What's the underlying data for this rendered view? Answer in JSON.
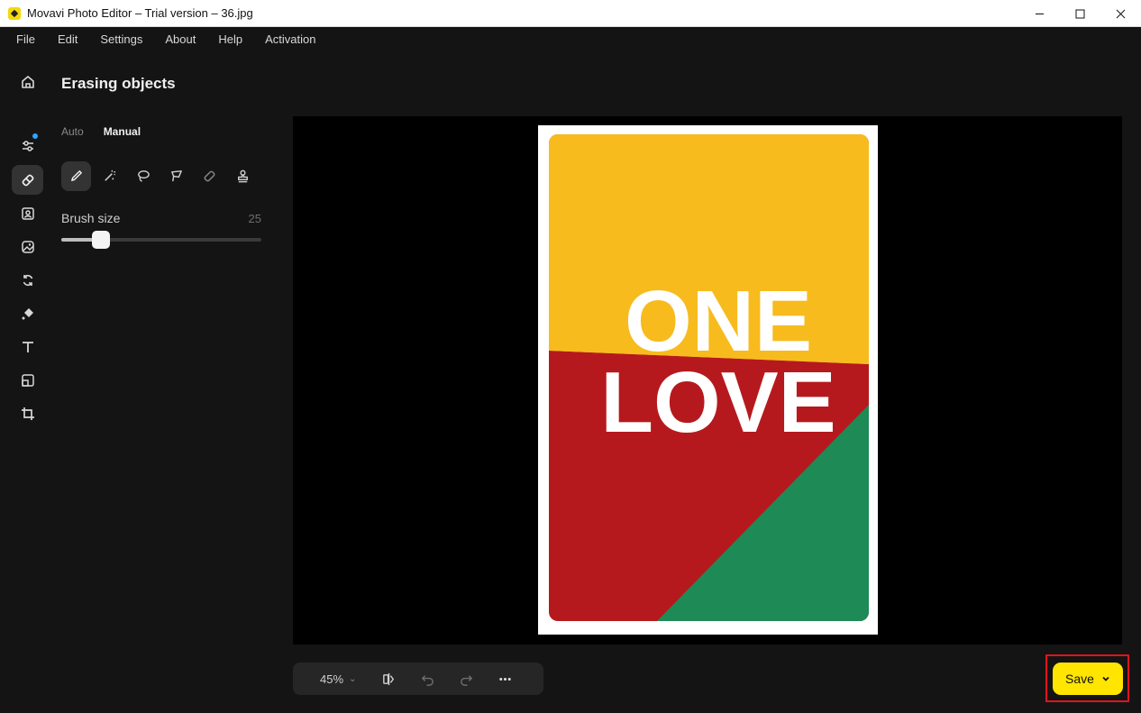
{
  "window": {
    "title": "Movavi Photo Editor – Trial version – 36.jpg",
    "controls": [
      "minimize",
      "maximize",
      "close"
    ]
  },
  "menu": [
    "File",
    "Edit",
    "Settings",
    "About",
    "Help",
    "Activation"
  ],
  "rail": {
    "items": [
      "home-icon",
      "adjust-icon",
      "eraser-icon",
      "portrait-icon",
      "replace-background-icon",
      "transform-icon",
      "effects-icon",
      "text-icon",
      "frame-icon",
      "crop-icon"
    ],
    "active": "eraser-icon"
  },
  "panel": {
    "title": "Erasing objects",
    "modes": [
      "Auto",
      "Manual"
    ],
    "active_mode": "Manual",
    "tools": [
      "brush-icon",
      "magic-wand-icon",
      "lasso-icon",
      "polygon-lasso-icon",
      "eraser-tool-icon",
      "stamp-icon"
    ],
    "brush_size_label": "Brush size",
    "brush_size_value": "25",
    "brush_size_fraction": 0.2
  },
  "image": {
    "line1": "ONE",
    "line2": "LOVE",
    "colors": {
      "yellow": "#f7bb1e",
      "red": "#b6191d",
      "green": "#1e8a56"
    }
  },
  "toolbar": {
    "zoom": "45%",
    "icons": [
      "compare-icon",
      "undo-icon",
      "redo-icon",
      "more-icon"
    ]
  },
  "save": {
    "label": "Save"
  }
}
